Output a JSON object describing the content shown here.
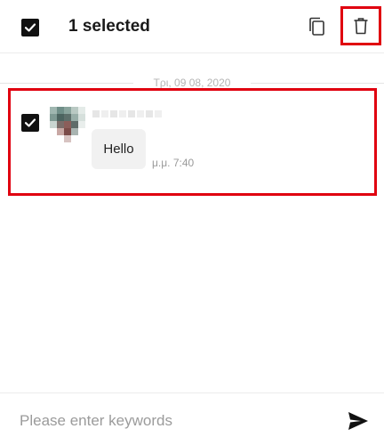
{
  "header": {
    "title": "1 selected",
    "select_all_icon": "checkbox-checked-icon",
    "copy_icon": "copy-icon",
    "delete_icon": "trash-icon",
    "highlight_color": "#e0000f"
  },
  "chat": {
    "date": "Τρι, 09 08, 2020",
    "message": {
      "selected": true,
      "text": "Hello",
      "time": "μ.μ. 7:40",
      "avatar_icon": "avatar-blurred"
    }
  },
  "composer": {
    "placeholder": "Please enter keywords",
    "send_icon": "send-icon"
  }
}
